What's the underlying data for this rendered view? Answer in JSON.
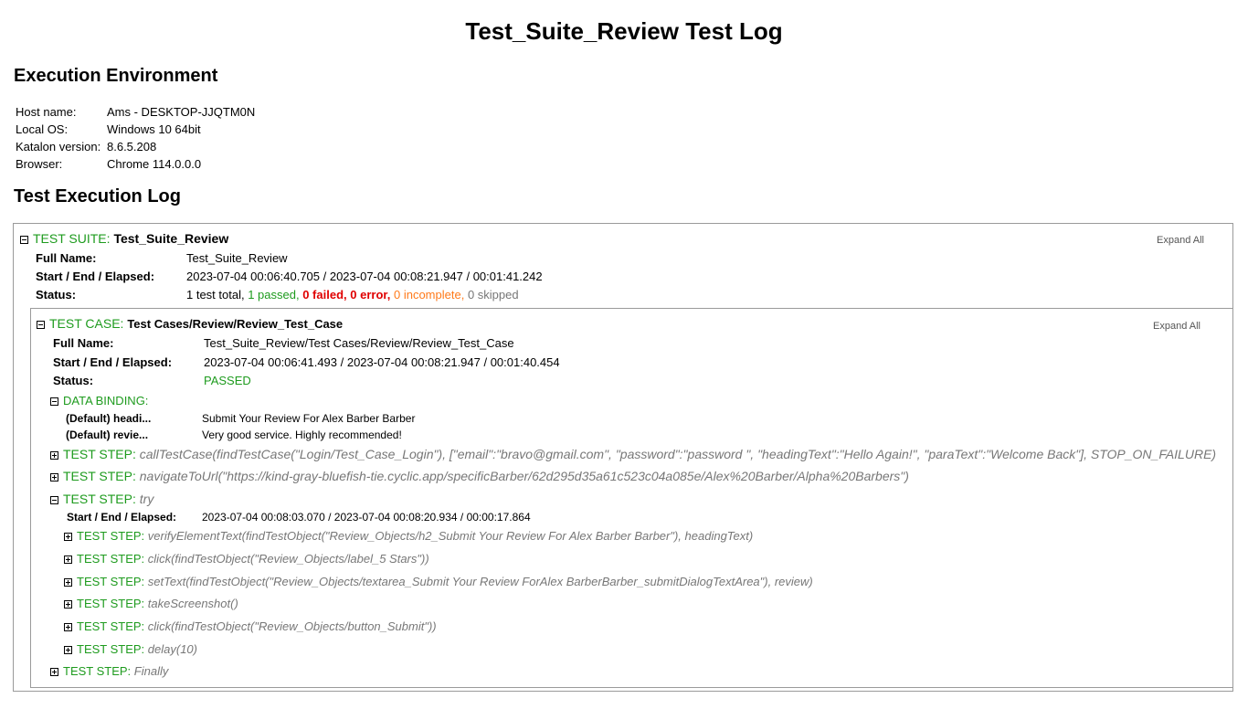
{
  "title": "Test_Suite_Review Test Log",
  "environment": {
    "heading": "Execution Environment",
    "rows": [
      {
        "label": "Host name:",
        "value": "Ams - DESKTOP-JJQTM0N"
      },
      {
        "label": "Local OS:",
        "value": "Windows 10 64bit"
      },
      {
        "label": "Katalon version:",
        "value": "8.6.5.208"
      },
      {
        "label": "Browser:",
        "value": "Chrome 114.0.0.0"
      }
    ]
  },
  "log": {
    "heading": "Test Execution Log",
    "expand_all": "Expand All",
    "suite": {
      "prefix": "TEST SUITE:",
      "name": "Test_Suite_Review",
      "full_name_label": "Full Name:",
      "full_name": "Test_Suite_Review",
      "times_label": "Start / End / Elapsed:",
      "times": "2023-07-04 00:06:40.705 / 2023-07-04 00:08:21.947 / 00:01:41.242",
      "status_label": "Status:",
      "status": {
        "total": "1 test total,",
        "passed": "1 passed,",
        "failed": "0 failed,",
        "error": "0 error,",
        "incomplete": "0 incomplete,",
        "skipped": "0 skipped"
      }
    },
    "case": {
      "prefix": "TEST CASE:",
      "name": "Test Cases/Review/Review_Test_Case",
      "full_name_label": "Full Name:",
      "full_name": "Test_Suite_Review/Test Cases/Review/Review_Test_Case",
      "times_label": "Start / End / Elapsed:",
      "times": "2023-07-04 00:06:41.493 / 2023-07-04 00:08:21.947 / 00:01:40.454",
      "status_label": "Status:",
      "status": "PASSED",
      "data_binding": {
        "label": "DATA BINDING:",
        "rows": [
          {
            "key": "(Default) headi...",
            "value": "Submit Your Review For Alex Barber Barber"
          },
          {
            "key": "(Default) revie...",
            "value": "Very good service. Highly recommended!"
          }
        ]
      },
      "step_prefix": "TEST STEP:",
      "steps": [
        "callTestCase(findTestCase(\"Login/Test_Case_Login\"), [\"email\":\"bravo@gmail.com\", \"password\":\"password \", \"headingText\":\"Hello Again!\", \"paraText\":\"Welcome Back\"], STOP_ON_FAILURE)",
        "navigateToUrl(\"https://kind-gray-bluefish-tie.cyclic.app/specificBarber/62d295d35a61c523c04a085e/Alex%20Barber/Alpha%20Barbers\")",
        "try"
      ],
      "try_times_label": "Start / End / Elapsed:",
      "try_times": "2023-07-04 00:08:03.070 / 2023-07-04 00:08:20.934 / 00:00:17.864",
      "substeps": [
        "verifyElementText(findTestObject(\"Review_Objects/h2_Submit Your Review For Alex Barber Barber\"), headingText)",
        "click(findTestObject(\"Review_Objects/label_5 Stars\"))",
        "setText(findTestObject(\"Review_Objects/textarea_Submit Your Review ForAlex BarberBarber_submitDialogTextArea\"), review)",
        "takeScreenshot()",
        "click(findTestObject(\"Review_Objects/button_Submit\"))",
        "delay(10)"
      ],
      "final_step": "Finally"
    }
  }
}
